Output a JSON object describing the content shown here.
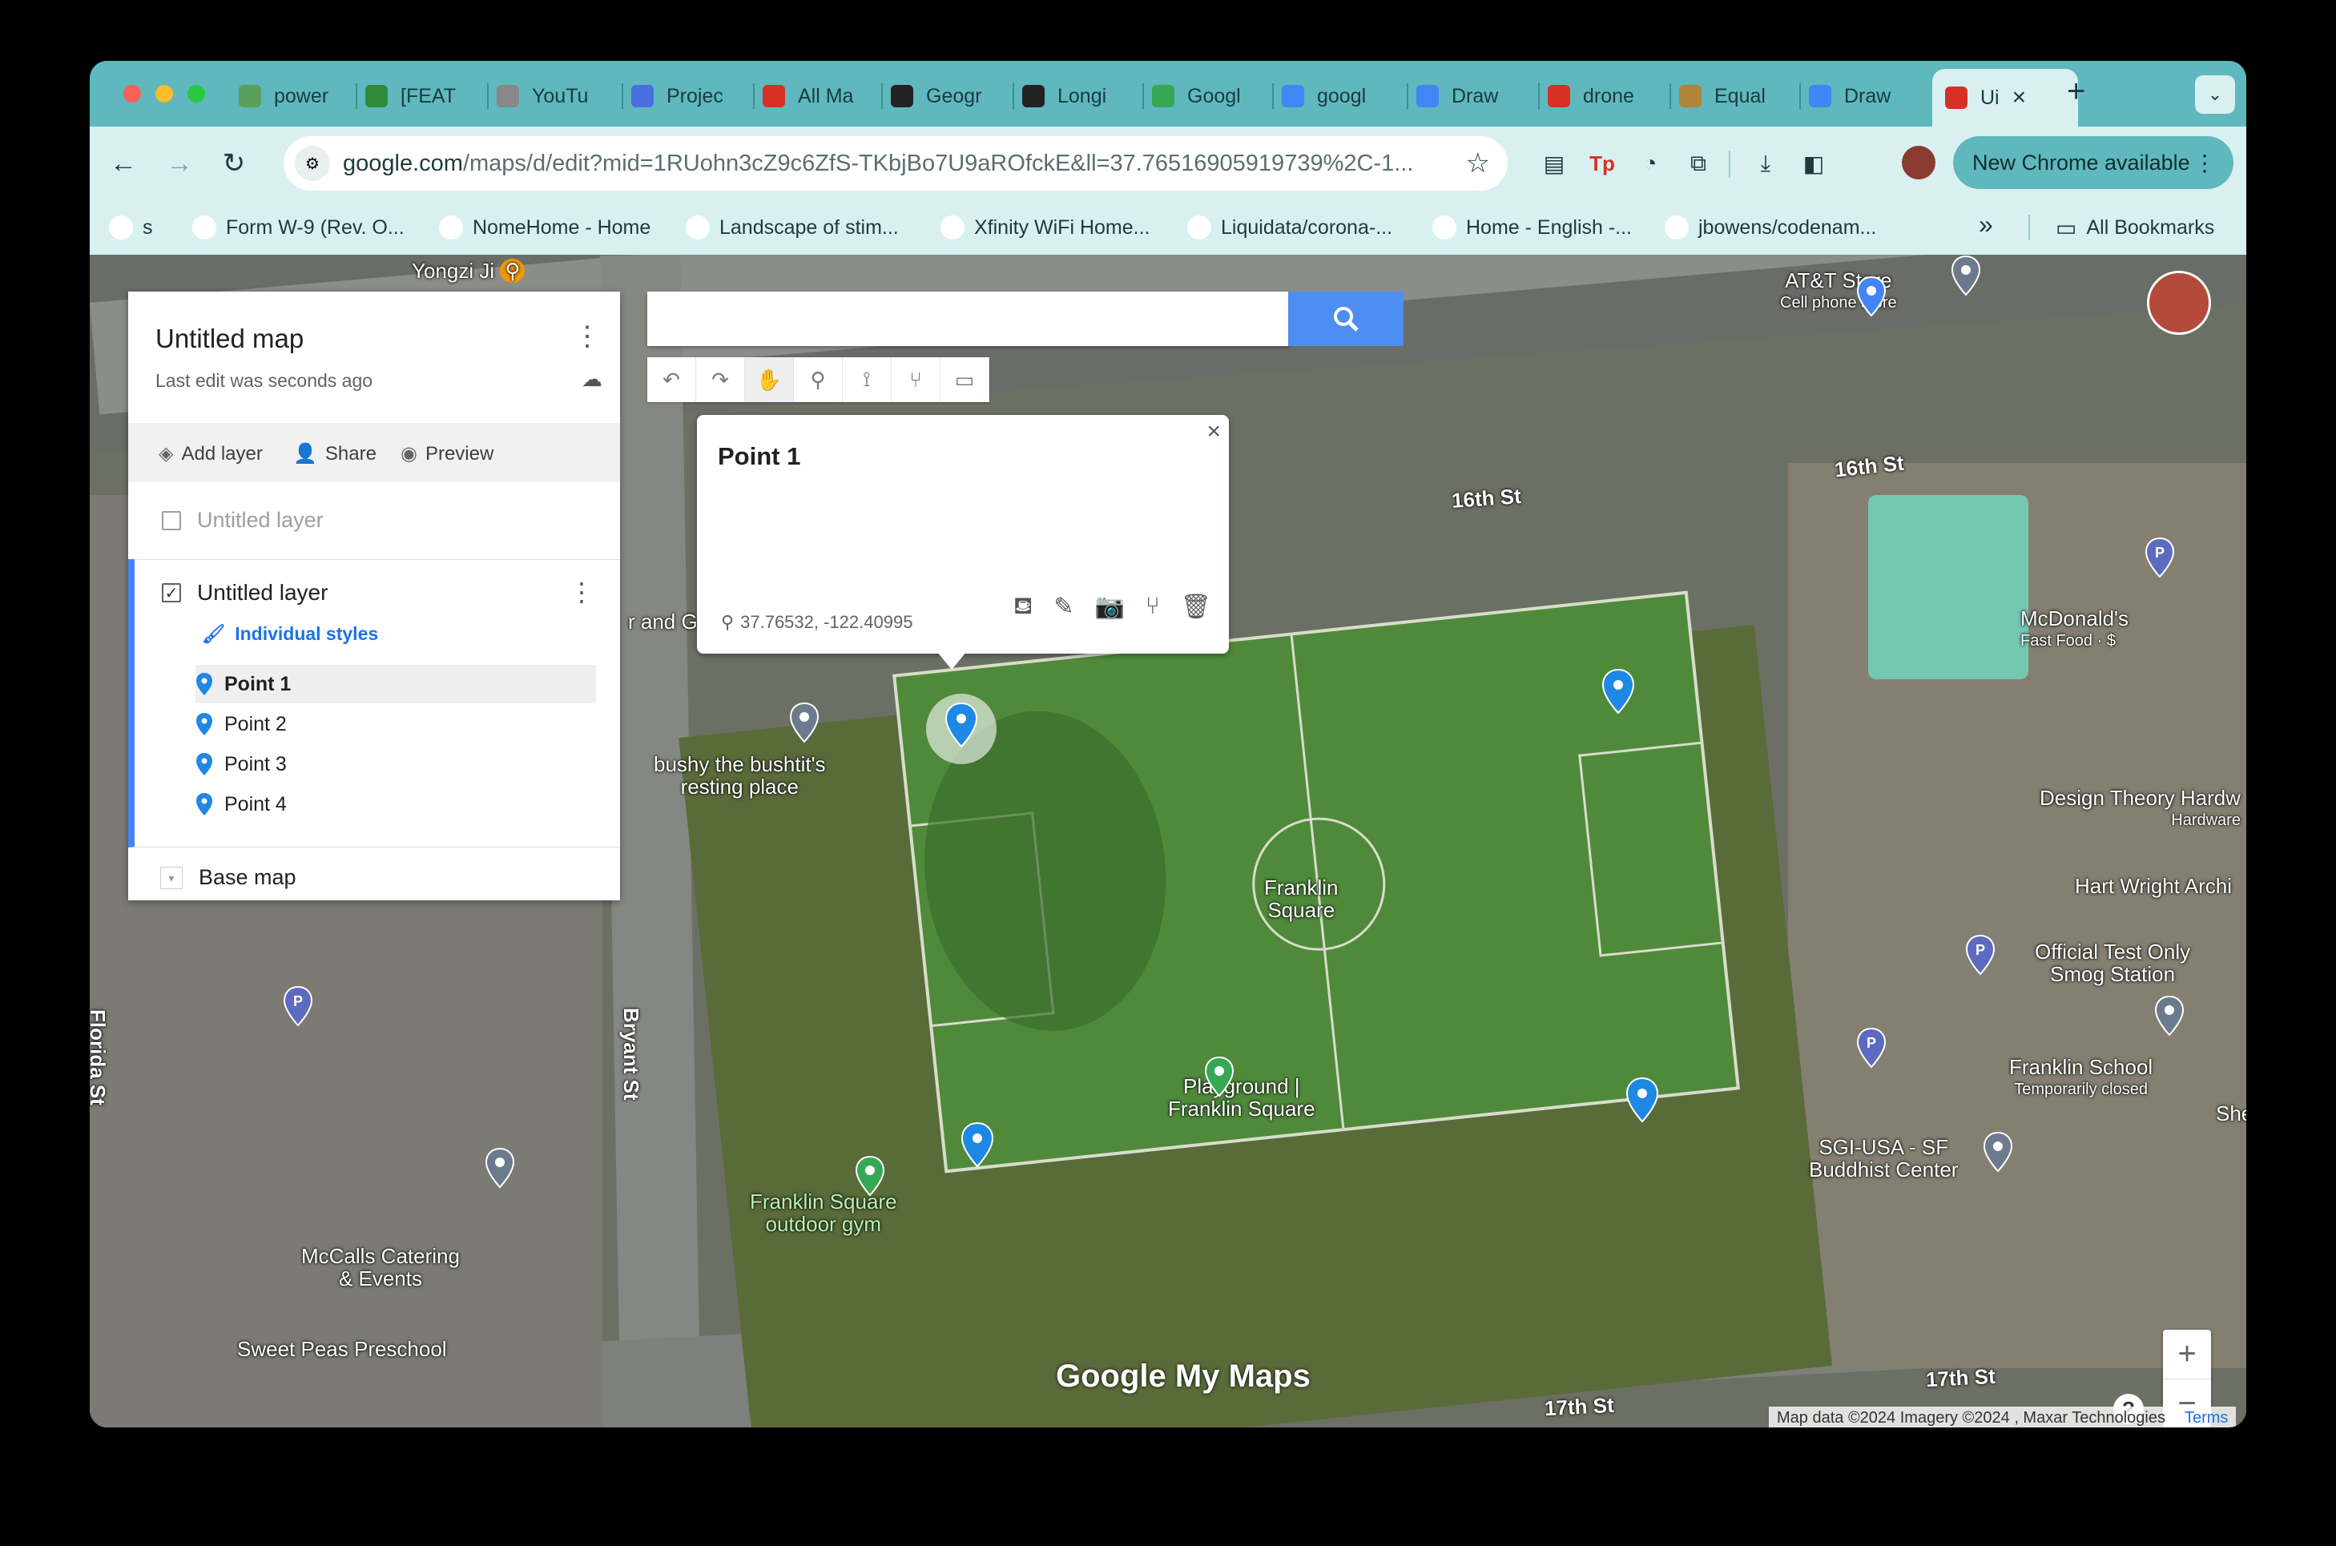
{
  "browser": {
    "tabs": [
      {
        "label": "power",
        "color": "#5aa05a"
      },
      {
        "label": "[FEAT",
        "color": "#2f8a3c"
      },
      {
        "label": "YouTu",
        "color": "#888888"
      },
      {
        "label": "Projec",
        "color": "#4a6ee0"
      },
      {
        "label": "All Ma",
        "color": "#d93025"
      },
      {
        "label": "Geogr",
        "color": "#222222"
      },
      {
        "label": "Longi",
        "color": "#222222"
      },
      {
        "label": "Googl",
        "color": "#34a853"
      },
      {
        "label": "googl",
        "color": "#4285f4"
      },
      {
        "label": "Draw",
        "color": "#4285f4"
      },
      {
        "label": "drone",
        "color": "#d93025"
      },
      {
        "label": "Equal",
        "color": "#b0843a"
      },
      {
        "label": "Draw",
        "color": "#4285f4"
      },
      {
        "label": "Ui",
        "color": "#d93025",
        "active": true
      }
    ],
    "new_tab_label": "+",
    "url_host": "google.com",
    "url_path": "/maps/d/edit?mid=1RUohn3cZ9c6ZfS-TKbjBo7U9aROfckE&ll=37.76516905919739%2C-1...",
    "new_chrome_label": "New Chrome available",
    "bookmarks": [
      {
        "label": "s",
        "icon": "amazon-icon"
      },
      {
        "label": "Form W-9 (Rev. O...",
        "icon": "irs-icon"
      },
      {
        "label": "NomeHome - Home",
        "icon": "globe-icon"
      },
      {
        "label": "Landscape of stim...",
        "icon": "br-icon"
      },
      {
        "label": "Xfinity WiFi Home...",
        "icon": "x-icon"
      },
      {
        "label": "Liquidata/corona-...",
        "icon": "liquidata-icon"
      },
      {
        "label": "Home - English -...",
        "icon": "home-icon"
      },
      {
        "label": "jbowens/codenam...",
        "icon": "github-icon"
      }
    ],
    "all_bookmarks_label": "All Bookmarks",
    "chevron_label": "»"
  },
  "panel": {
    "map_title": "Untitled map",
    "last_edit": "Last edit was seconds ago",
    "add_layer": "Add layer",
    "share": "Share",
    "preview": "Preview",
    "layer1_name": "Untitled layer",
    "layer2_name": "Untitled layer",
    "styles_label": "Individual styles",
    "features": [
      "Point 1",
      "Point 2",
      "Point 3",
      "Point 4"
    ],
    "base_map": "Base map"
  },
  "info_window": {
    "title": "Point 1",
    "coords": "37.76532, -122.40995"
  },
  "map_labels": {
    "yongzi": "Yongzi Ji",
    "att": "AT&T Store",
    "att_sub": "Cell phone store",
    "st16a": "16th St",
    "st16b": "16th St",
    "and_g": "r and G",
    "bushy": "bushy the bushtit's\nresting place",
    "franklin": "Franklin\nSquare",
    "mcd": "McDonald's",
    "mcd_sub": "Fast Food · $",
    "design": "Design Theory Hardw",
    "design_sub": "Hardware",
    "hart": "Hart Wright Archi",
    "smog": "Official Test Only\nSmog Station",
    "school": "Franklin School",
    "school_sub": "Temporarily closed",
    "she": "She",
    "sgi": "SGI-USA - SF\nBuddhist Center",
    "playground": "Playground |\nFranklin Square",
    "gym": "Franklin Square\noutdoor gym",
    "bryant": "Bryant St",
    "florida": "Florida St",
    "mccalls": "McCalls Catering\n& Events",
    "sweet": "Sweet Peas Preschool",
    "st17a": "17th St",
    "st17b": "17th St",
    "mymaps": "Google My Maps",
    "attribution": "Map data ©2024 Imagery ©2024 , Maxar Technologies",
    "terms": "Terms",
    "help": "?",
    "zoom_in": "+",
    "zoom_out": "−"
  }
}
